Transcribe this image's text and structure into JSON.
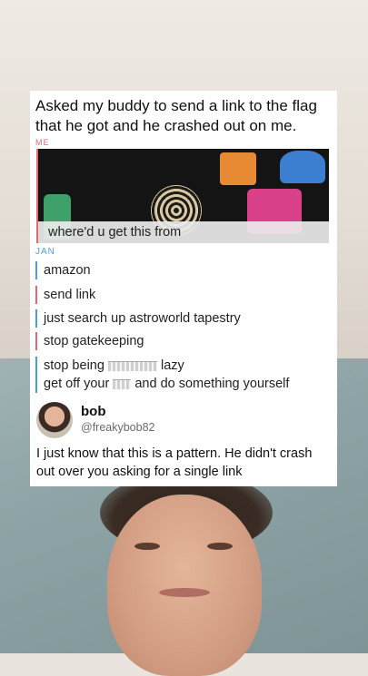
{
  "caption": "Asked my buddy to send a link to the flag that he got and he crashed out on me.",
  "chat": {
    "me_label": "ME",
    "image_message": "where'd u get this from",
    "jan_label": "JAN",
    "messages": [
      {
        "sender": "them",
        "text": "amazon"
      },
      {
        "sender": "me",
        "text": "send link"
      },
      {
        "sender": "them",
        "text": "just search up astroworld tapestry"
      },
      {
        "sender": "me",
        "text": "stop gatekeeping"
      }
    ],
    "last_message": {
      "sender": "them",
      "line1_start": "stop being",
      "line1_end": "lazy",
      "line2_start": "get off your",
      "line2_end": "and do something yourself"
    }
  },
  "tweet": {
    "name": "bob",
    "handle": "@freakybob82",
    "body": "I just know that this is a pattern. He didn't crash out over you asking for a single link"
  },
  "colors": {
    "me_accent": "#e06a74",
    "them_accent": "#4aa1d8"
  }
}
